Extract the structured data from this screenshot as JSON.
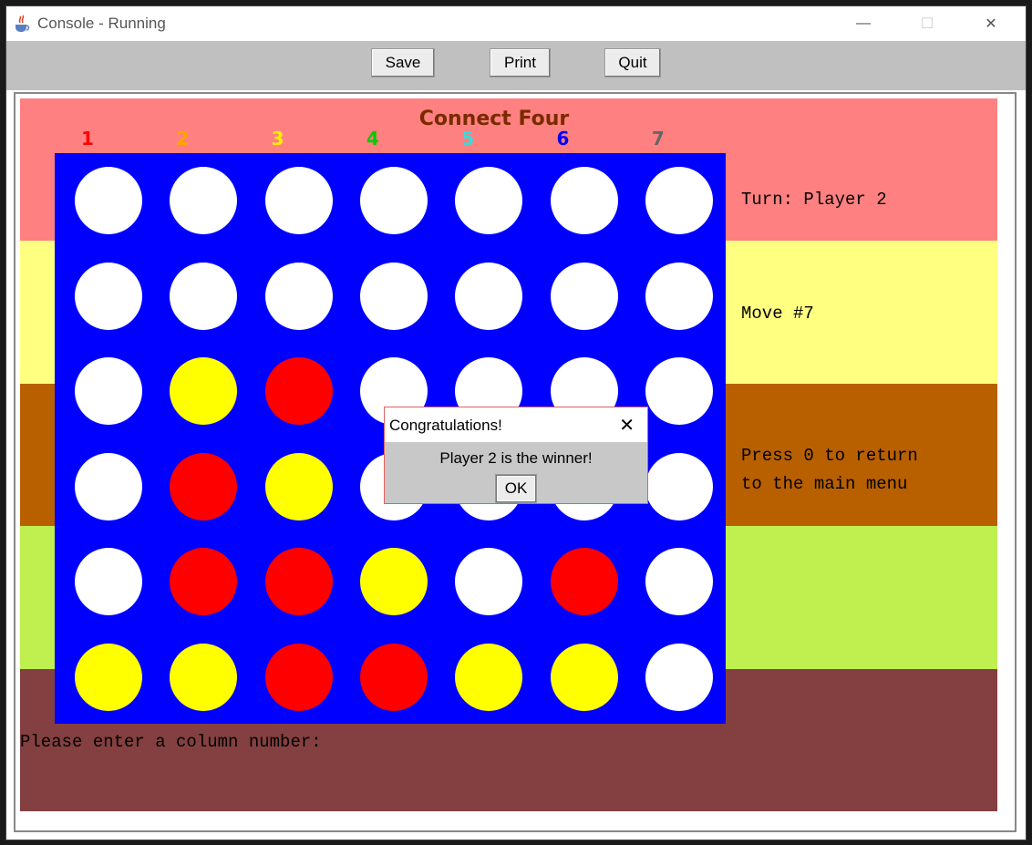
{
  "window": {
    "title": "Console - Running",
    "minimize": "—",
    "maximize": "☐",
    "close": "✕"
  },
  "toolbar": {
    "save_label": "Save",
    "print_label": "Print",
    "quit_label": "Quit"
  },
  "game": {
    "title": "Connect Four",
    "columns": [
      {
        "label": "1",
        "color": "#ff0000"
      },
      {
        "label": "2",
        "color": "#ffa500"
      },
      {
        "label": "3",
        "color": "#ffee00"
      },
      {
        "label": "4",
        "color": "#00cc00"
      },
      {
        "label": "5",
        "color": "#33dddd"
      },
      {
        "label": "6",
        "color": "#0000ff"
      },
      {
        "label": "7",
        "color": "#666666"
      }
    ],
    "board": [
      [
        "empty",
        "empty",
        "empty",
        "empty",
        "empty",
        "empty",
        "empty"
      ],
      [
        "empty",
        "empty",
        "empty",
        "empty",
        "empty",
        "empty",
        "empty"
      ],
      [
        "empty",
        "yellow",
        "red",
        "empty",
        "empty",
        "empty",
        "empty"
      ],
      [
        "empty",
        "red",
        "yellow",
        "empty",
        "empty",
        "empty",
        "empty"
      ],
      [
        "empty",
        "red",
        "red",
        "yellow",
        "empty",
        "red",
        "empty"
      ],
      [
        "yellow",
        "yellow",
        "red",
        "red",
        "yellow",
        "yellow",
        "empty"
      ]
    ],
    "piece_colors": {
      "empty": "#ffffff",
      "red": "#ff0000",
      "yellow": "#ffff00",
      "board": "#0000ff"
    },
    "band_colors": [
      "#ff8080",
      "#ffff80",
      "#b86000",
      "#bff050",
      "#844040"
    ],
    "turn_text": "Turn: Player 2",
    "move_text": "Move #7",
    "menu_hint": "Press 0 to return\nto the main menu",
    "prompt": "Please enter a column number:"
  },
  "dialog": {
    "title": "Congratulations!",
    "message": "Player 2 is the winner!",
    "ok_label": "OK",
    "close": "✕"
  }
}
